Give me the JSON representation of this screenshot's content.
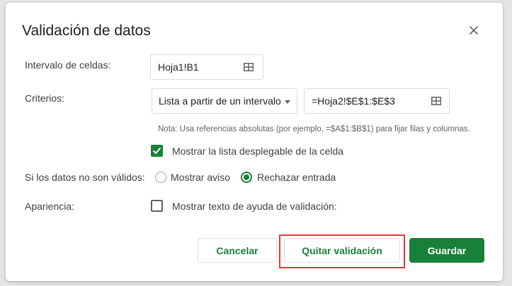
{
  "dialog": {
    "title": "Validación de datos",
    "close_icon": "close-icon"
  },
  "range": {
    "label": "Intervalo de celdas:",
    "value": "Hoja1!B1",
    "icon": "grid-icon"
  },
  "criteria": {
    "label": "Criterios:",
    "type_value": "Lista a partir de un intervalo",
    "range_value": "=Hoja2!$E$1:$E$3",
    "note": "Nota: Usa referencias absolutas (por ejemplo, =$A$1:$B$1) para fijar filas y columnas.",
    "show_dropdown_label": "Mostrar la lista desplegable de la celda",
    "show_dropdown_checked": true
  },
  "invalid": {
    "label": "Si los datos no son válidos:",
    "options": [
      "Mostrar aviso",
      "Rechazar entrada"
    ],
    "selected": "Rechazar entrada"
  },
  "appearance": {
    "label": "Apariencia:",
    "help_text_label": "Mostrar texto de ayuda de validación:",
    "help_text_checked": false
  },
  "buttons": {
    "cancel": "Cancelar",
    "remove": "Quitar validación",
    "save": "Guardar"
  },
  "colors": {
    "accent": "#188038",
    "highlight": "#e53935"
  }
}
